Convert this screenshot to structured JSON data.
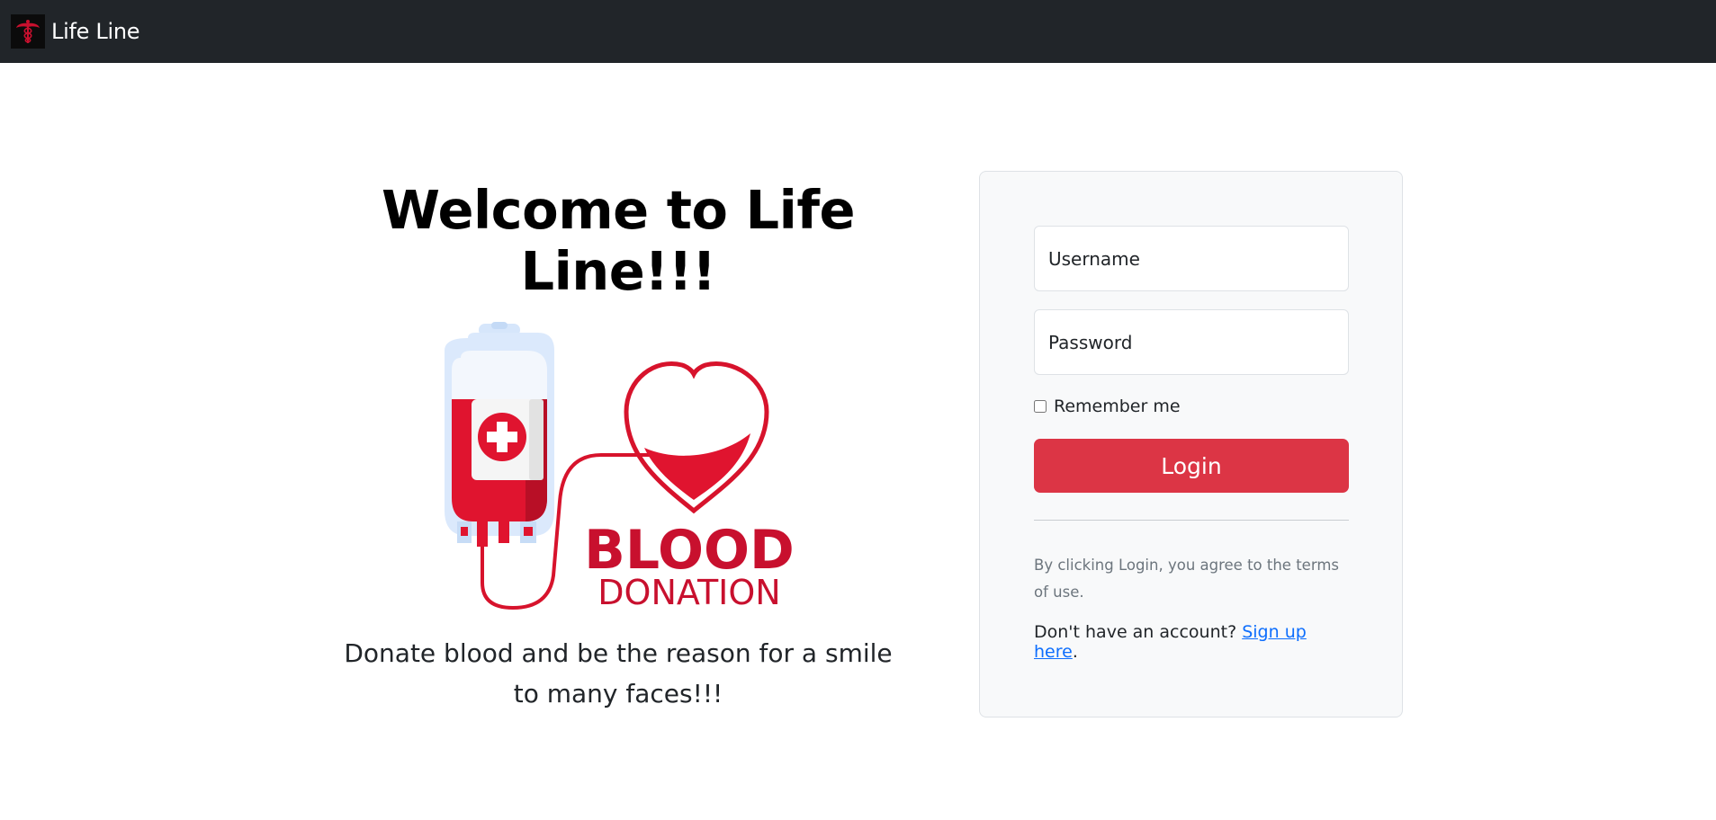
{
  "navbar": {
    "brand": "Life Line",
    "logo_icon": "caduceus-icon",
    "background": "#212529"
  },
  "hero": {
    "title": "Welcome to Life Line!!!",
    "illustration": {
      "icon": "blood-bag-heart-icon",
      "line1": "BLOOD",
      "line2": "DONATION"
    },
    "subtitle": "Donate blood and be the reason for a smile to many faces!!!"
  },
  "login": {
    "username_placeholder": "Username",
    "password_placeholder": "Password",
    "remember_label": "Remember me",
    "remember_checked": false,
    "button_label": "Login",
    "terms_text": "By clicking Login, you agree to the terms of use.",
    "signup_prefix": "Don't have an account? ",
    "signup_link": "Sign up here",
    "signup_suffix": "."
  },
  "colors": {
    "accent": "#dc3545",
    "brand_red": "#c8102e",
    "link": "#0d6efd",
    "card_bg": "#f8f9fa"
  }
}
